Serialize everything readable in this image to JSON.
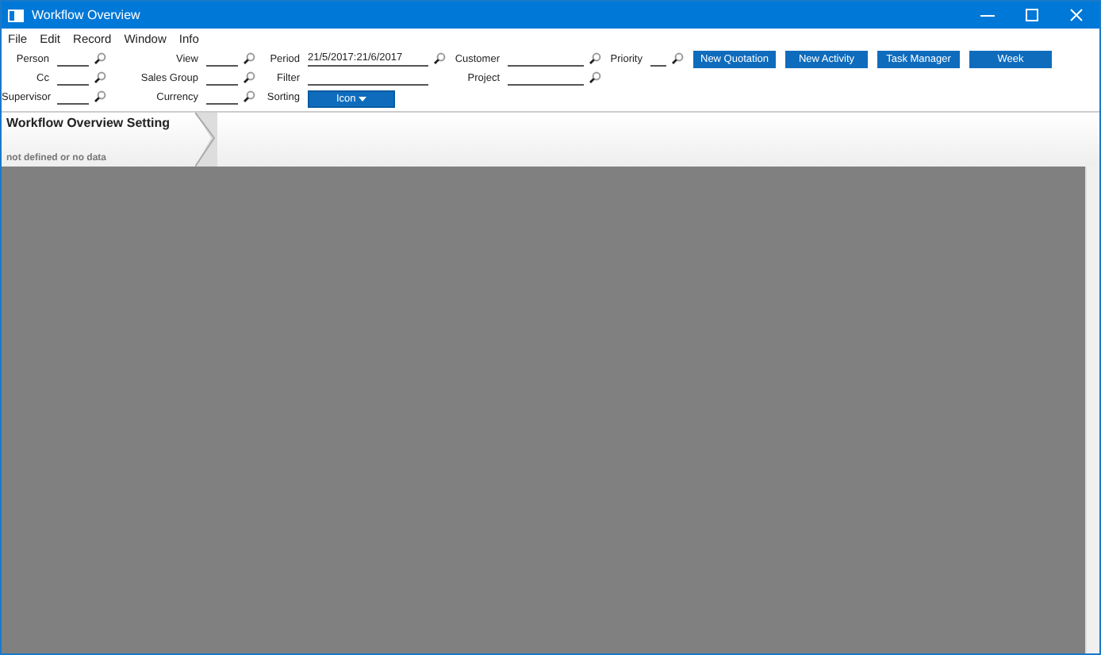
{
  "window": {
    "title": "Workflow Overview"
  },
  "menu": [
    "File",
    "Edit",
    "Record",
    "Window",
    "Info"
  ],
  "field_columns": [
    [
      {
        "label": "Person"
      },
      {
        "label": "Cc"
      },
      {
        "label": "Supervisor"
      }
    ],
    [
      {
        "label": "View"
      },
      {
        "label": "Sales Group"
      },
      {
        "label": "Currency"
      }
    ],
    [
      {
        "label": "Period",
        "value": "21/5/2017:21/6/2017",
        "kind": "lookup"
      },
      {
        "label": "Filter",
        "kind": "plain"
      },
      {
        "label": "Sorting",
        "value": "Icon",
        "kind": "dropdown"
      }
    ],
    [
      {
        "label": "Customer"
      },
      {
        "label": "Project"
      }
    ],
    [
      {
        "label": "Priority"
      }
    ]
  ],
  "buttons": [
    "New Quotation",
    "New Activity",
    "Task Manager",
    "Week"
  ],
  "setting_tab": {
    "title": "Workflow Overview Setting",
    "subtitle": "not defined or no data"
  }
}
